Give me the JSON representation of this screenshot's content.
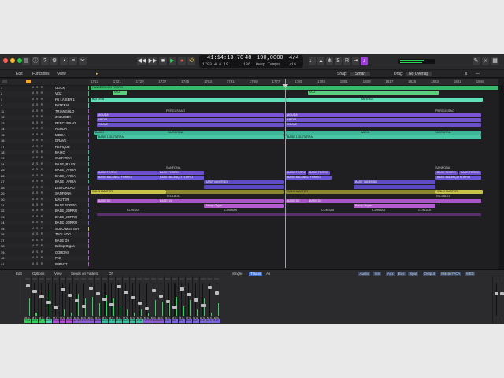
{
  "transport": {
    "position": "41:14:13.70",
    "bars": "1783  4  4  19",
    "bpm_top": "48",
    "bpm": "190,0000",
    "tempo_label": "136",
    "tempo_mode": "Keep Tempo",
    "sig_top": "4/4",
    "sig_bottom": "/16"
  },
  "menubar": {
    "edit": "Edit",
    "functions": "Functions",
    "view": "View",
    "snap_label": "Snap:",
    "snap_value": "Smart",
    "drag_label": "Drag:",
    "drag_value": "No Overlap"
  },
  "ruler": [
    "1713",
    "1721",
    "1729",
    "1737",
    "1745",
    "1753",
    "1761",
    "1769",
    "1777",
    "1785",
    "1793",
    "1801",
    "1809",
    "1817",
    "1825",
    "1833",
    "1841",
    "1849"
  ],
  "tracks": [
    {
      "num": "1",
      "name": "CLICK",
      "color": "#2fd35a"
    },
    {
      "num": "2",
      "name": "VOZ",
      "color": "#39c06b"
    },
    {
      "num": "3",
      "name": "FX LAISER 1",
      "color": "#44b97a"
    },
    {
      "num": "4",
      "name": "BATERIA",
      "color": "#4ad8b0"
    },
    {
      "num": "11",
      "name": "TRIANGULO",
      "color": "#b24fd6"
    },
    {
      "num": "12",
      "name": "ZABUMBA",
      "color": "#b24fd6"
    },
    {
      "num": "13",
      "name": "PERCUSSAO",
      "color": "#b24fd6"
    },
    {
      "num": "14",
      "name": "AGUDA",
      "color": "#8c5ad8"
    },
    {
      "num": "15",
      "name": "MEDIA",
      "color": "#8c5ad8"
    },
    {
      "num": "16",
      "name": "GRAVE",
      "color": "#8c5ad8"
    },
    {
      "num": "17",
      "name": "REPIQUE",
      "color": "#8c5ad8"
    },
    {
      "num": "18",
      "name": "BAIXO",
      "color": "#36c3a3"
    },
    {
      "num": "19",
      "name": "GUITARRA",
      "color": "#36c3a3"
    },
    {
      "num": "24",
      "name": "BASE_RA FX",
      "color": "#36c3a3"
    },
    {
      "num": "25",
      "name": "BASE_ ARRA",
      "color": "#36c3a3"
    },
    {
      "num": "26",
      "name": "BASE_ ARRA",
      "color": "#36c3a3"
    },
    {
      "num": "27",
      "name": "BASE_ ARRA",
      "color": "#36c3a3"
    },
    {
      "num": "28",
      "name": "DISTORCAO",
      "color": "#8c5ad8"
    },
    {
      "num": "29",
      "name": "SANFONA",
      "color": "#8c5ad8"
    },
    {
      "num": "30",
      "name": "MASTER",
      "color": "#8c5ad8"
    },
    {
      "num": "31",
      "name": "BASE FORRO",
      "color": "#7a63e0"
    },
    {
      "num": "32",
      "name": "BASE_JORRO",
      "color": "#7a63e0"
    },
    {
      "num": "33",
      "name": "BASE_JORRO",
      "color": "#7a63e0"
    },
    {
      "num": "34",
      "name": "BASE_JORRO",
      "color": "#7a63e0"
    },
    {
      "num": "35",
      "name": "SOLO MASTER",
      "color": "#c9c24a"
    },
    {
      "num": "36",
      "name": "TECLADO",
      "color": "#b05fd0"
    },
    {
      "num": "37",
      "name": "BASE DX",
      "color": "#b05fd0"
    },
    {
      "num": "38",
      "name": "Bebop Organ",
      "color": "#b05fd0"
    },
    {
      "num": "39",
      "name": "CORDAS",
      "color": "#b05fd0"
    },
    {
      "num": "40",
      "name": "PAD",
      "color": "#b05fd0"
    },
    {
      "num": "41",
      "name": "IMPACT",
      "color": "#b05fd0"
    }
  ],
  "regions": {
    "pandeiro": "PANDEIRO DO FORRO",
    "voz": "VOZ",
    "bateria": "BATERIA",
    "percussao": "PERCUSSAO",
    "aguda": "AGUDA",
    "media": "MEDIA",
    "grave": "GRAVE",
    "baixo": "BAIXO",
    "guitarra": "GUITARRA",
    "base_guitarra": "BASE 1 GUITARRA",
    "sanfona": "SANFONA",
    "base_forro": "BASE FORRO",
    "base_balanco": "BASE BALANÇO FORRO",
    "base_vanerao": "BASE VANERÃO",
    "solo_master": "SOLO MASTER",
    "teclado": "TECLADO",
    "base_dx": "BASE DX",
    "bebop": "Bebop Organ",
    "cordas": "CORDAS"
  },
  "mixbar": {
    "edit": "Edit",
    "options": "Options",
    "view": "View",
    "sends_label": "Sends on Faders:",
    "sends_value": "Off",
    "single": "Single",
    "tracks": "Tracks",
    "all": "All",
    "filters": [
      "Audio",
      "Inst",
      "Aux",
      "Bus",
      "Input",
      "Output",
      "Master/VCA",
      "MIDI"
    ]
  },
  "strips": [
    {
      "name": "Click",
      "color": "#2fd35a",
      "lvl": 0.55
    },
    {
      "name": "VOZ",
      "color": "#2fd35a",
      "lvl": 0.1
    },
    {
      "name": "FX LAISER_1",
      "color": "#2fd35a",
      "lvl": 0
    },
    {
      "name": "BATERIA",
      "color": "#4ad8b0",
      "lvl": 0.8
    },
    {
      "name": "TRIANGULO",
      "color": "#b24fd6",
      "lvl": 0
    },
    {
      "name": "ZABUMBA",
      "color": "#b24fd6",
      "lvl": 0.2
    },
    {
      "name": "PER...SAO",
      "color": "#b24fd6",
      "lvl": 0.1
    },
    {
      "name": "AGUDA",
      "color": "#8c5ad8",
      "lvl": 0.7
    },
    {
      "name": "MEDIA",
      "color": "#8c5ad8",
      "lvl": 0.55
    },
    {
      "name": "GRAVE",
      "color": "#8c5ad8",
      "lvl": 0.6
    },
    {
      "name": "REPIQUE",
      "color": "#8c5ad8",
      "lvl": 0.4
    },
    {
      "name": "BAIXO",
      "color": "#36c3a3",
      "lvl": 0.65
    },
    {
      "name": "GUITARRA",
      "color": "#36c3a3",
      "lvl": 0.55
    },
    {
      "name": "BASE_...aa",
      "color": "#36c3a3",
      "lvl": 0.3
    },
    {
      "name": "BASE...RRA",
      "color": "#36c3a3",
      "lvl": 0.2
    },
    {
      "name": "ARR...RA_2",
      "color": "#36c3a3",
      "lvl": 0.1
    },
    {
      "name": "ARR...RA_3",
      "color": "#36c3a3",
      "lvl": 0.2
    },
    {
      "name": "DISTORÇÃO",
      "color": "#8c5ad8",
      "lvl": 0.1
    },
    {
      "name": "SANFONA",
      "color": "#8c5ad8",
      "lvl": 0.5
    },
    {
      "name": "MASTER",
      "color": "#8c5ad8",
      "lvl": 0.45
    },
    {
      "name": "BAS...RRO",
      "color": "#7a63e0",
      "lvl": 0.4
    },
    {
      "name": "BAS...RRO",
      "color": "#7a63e0",
      "lvl": 0.6
    },
    {
      "name": "BAS...RRO",
      "color": "#7a63e0",
      "lvl": 0.3
    },
    {
      "name": "BAS...RRO",
      "color": "#7a63e0",
      "lvl": 0.5
    },
    {
      "name": "BAS...RRO",
      "color": "#7a63e0",
      "lvl": 0.2
    },
    {
      "name": "BAS...RRO",
      "color": "#7a63e0",
      "lvl": 0.55
    },
    {
      "name": "BAS...RRO",
      "color": "#7a63e0",
      "lvl": 0.1
    },
    {
      "name": "BAS...RRO",
      "color": "#7a63e0",
      "lvl": 0.4
    }
  ]
}
